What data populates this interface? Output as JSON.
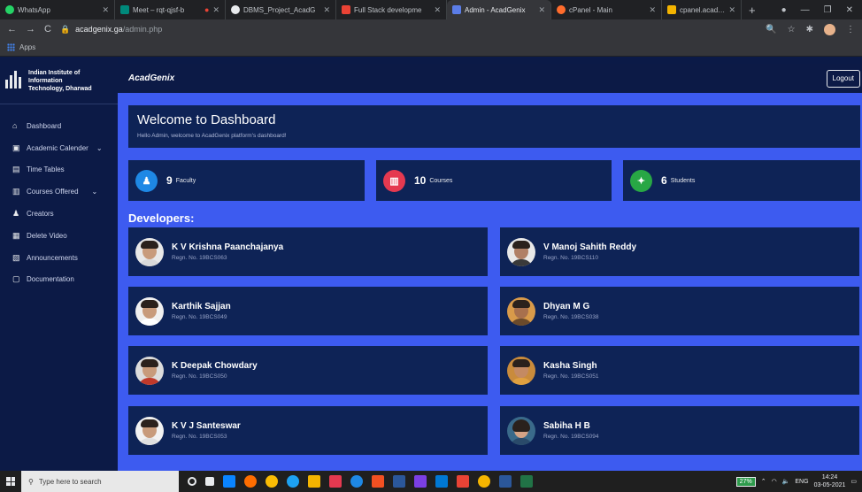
{
  "browser": {
    "tabs": [
      {
        "title": "WhatsApp",
        "favicon_color": "#25d366"
      },
      {
        "title": "Meet – rqt-qjsf-b",
        "favicon_color": "#00897b"
      },
      {
        "title": "DBMS_Project_AcadG",
        "favicon_color": "#e8eaed"
      },
      {
        "title": "Full Stack developme",
        "favicon_color": "#ea4335"
      },
      {
        "title": "Admin - AcadGenix",
        "favicon_color": "#5b7de8"
      },
      {
        "title": "cPanel - Main",
        "favicon_color": "#ff6c2c"
      },
      {
        "title": "cpanel.acadgenix.ga",
        "favicon_color": "#f4b400"
      }
    ],
    "url_host": "acadgenix.ga",
    "url_path": "/admin.php",
    "bookmarks_label": "Apps"
  },
  "sidebar": {
    "institute": [
      "Indian Institute of",
      "Information",
      "Technology, Dharwad"
    ],
    "items": [
      {
        "label": "Dashboard",
        "icon": "home-icon",
        "chevron": false
      },
      {
        "label": "Academic Calender",
        "icon": "calendar-icon",
        "chevron": true
      },
      {
        "label": "Time Tables",
        "icon": "table-icon",
        "chevron": false
      },
      {
        "label": "Courses Offered",
        "icon": "books-icon",
        "chevron": true
      },
      {
        "label": "Creators",
        "icon": "user-icon",
        "chevron": false
      },
      {
        "label": "Delete Video",
        "icon": "video-icon",
        "chevron": false
      },
      {
        "label": "Announcements",
        "icon": "megaphone-icon",
        "chevron": false
      },
      {
        "label": "Documentation",
        "icon": "document-icon",
        "chevron": false
      }
    ]
  },
  "navbar": {
    "title": "AcadGenix",
    "logout_label": "Logout"
  },
  "welcome": {
    "title": "Welcome to Dashboard",
    "subtitle": "Hello Admin, welcome to AcadGenix platform's dashboard!"
  },
  "stats": [
    {
      "value": "9",
      "label": "Faculty",
      "color": "#1e88e5",
      "icon": "faculty-icon"
    },
    {
      "value": "10",
      "label": "Courses",
      "color": "#e53950",
      "icon": "courses-icon"
    },
    {
      "value": "6",
      "label": "Students",
      "color": "#28a745",
      "icon": "students-icon"
    }
  ],
  "developers_heading": "Developers:",
  "developers": [
    {
      "name": "K V Krishna Paanchajanya",
      "regn": "Regn. No. 19BCS063"
    },
    {
      "name": "V Manoj Sahith Reddy",
      "regn": "Regn. No. 19BCS110"
    },
    {
      "name": "Karthik Sajjan",
      "regn": "Regn. No. 19BCS049"
    },
    {
      "name": "Dhyan M G",
      "regn": "Regn. No. 19BCS038"
    },
    {
      "name": "K Deepak Chowdary",
      "regn": "Regn. No. 19BCS050"
    },
    {
      "name": "Kasha Singh",
      "regn": "Regn. No. 19BCS051"
    },
    {
      "name": "K V J Santeswar",
      "regn": "Regn. No. 19BCS053"
    },
    {
      "name": "Sabiha H B",
      "regn": "Regn. No. 19BCS094"
    }
  ],
  "taskbar": {
    "search_placeholder": "Type here to search",
    "battery": "27%",
    "lang": "ENG",
    "time": "14:24",
    "date": "03-05-2021"
  }
}
